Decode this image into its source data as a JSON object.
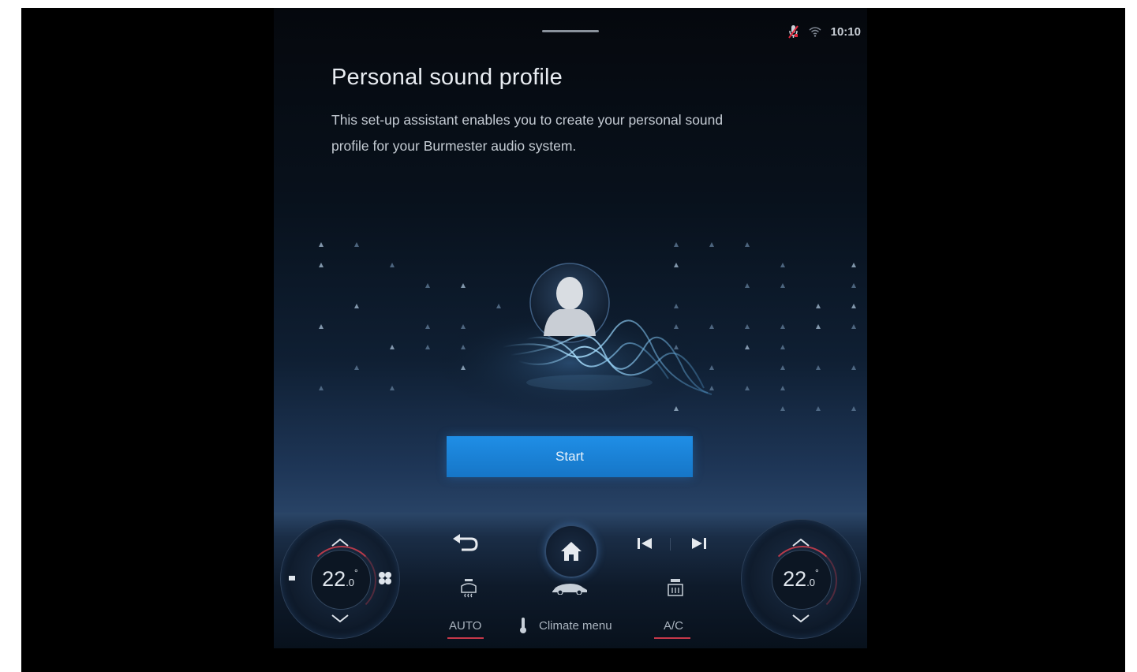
{
  "status_bar": {
    "time": "10:10",
    "icons": [
      "mic-muted-icon",
      "wifi-icon"
    ],
    "mic_color": "#e0283c"
  },
  "page": {
    "title": "Personal sound profile",
    "description": "This set-up assistant enables you to create your personal sound profile for your Burmester audio system."
  },
  "illustration": {
    "icon": "user-profile-icon"
  },
  "start_button": {
    "label": "Start",
    "color": "#1a82d8"
  },
  "climate": {
    "left_temp_value": "22",
    "left_temp_decimal": ".0",
    "left_temp_unit": "°",
    "right_temp_value": "22",
    "right_temp_decimal": ".0",
    "right_temp_unit": "°",
    "auto_label": "AUTO",
    "climate_menu_label": "Climate menu",
    "ac_label": "A/C",
    "indicator_color": "#c7384a"
  },
  "media": {
    "back_icon": "back-arrow-icon",
    "home_icon": "home-icon",
    "prev_icon": "skip-previous-icon",
    "next_icon": "skip-next-icon"
  }
}
